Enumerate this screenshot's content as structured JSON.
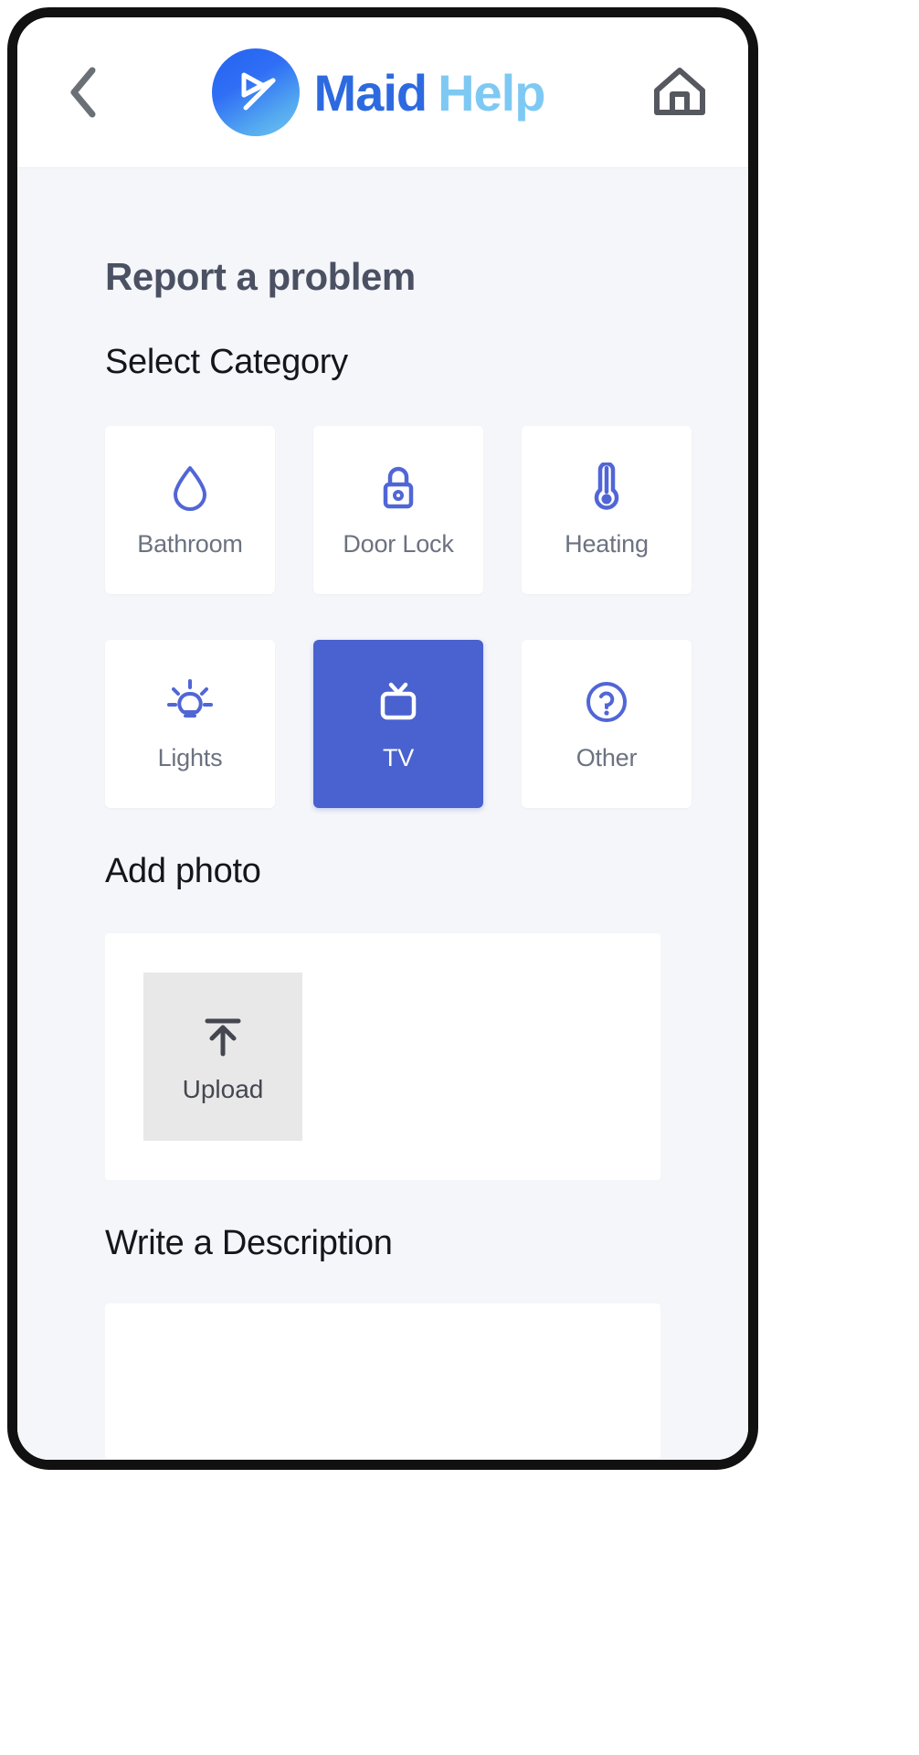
{
  "header": {
    "back_icon": "chevron-left-icon",
    "logo_icon": "maid-help-logo-icon",
    "brand_primary": "Maid",
    "brand_secondary": "Help",
    "home_icon": "home-icon"
  },
  "main": {
    "page_title": "Report a problem",
    "category_label": "Select Category",
    "categories": [
      {
        "id": "bathroom",
        "label": "Bathroom",
        "icon": "water-drop-icon",
        "selected": false
      },
      {
        "id": "door-lock",
        "label": "Door Lock",
        "icon": "lock-icon",
        "selected": false
      },
      {
        "id": "heating",
        "label": "Heating",
        "icon": "thermometer-icon",
        "selected": false
      },
      {
        "id": "lights",
        "label": "Lights",
        "icon": "lightbulb-icon",
        "selected": false
      },
      {
        "id": "tv",
        "label": "TV",
        "icon": "tv-icon",
        "selected": true
      },
      {
        "id": "other",
        "label": "Other",
        "icon": "question-circle-icon",
        "selected": false
      }
    ],
    "photo_label": "Add photo",
    "upload_label": "Upload",
    "upload_icon": "upload-arrow-icon",
    "description_label": "Write a Description",
    "description_value": "",
    "description_placeholder": ""
  },
  "colors": {
    "accent": "#4a62cf",
    "icon_blue": "#5166d6",
    "brand_primary": "#2d6ae0",
    "brand_secondary": "#7ec9f3",
    "page_bg": "#f5f6fa",
    "tile_bg": "#ffffff",
    "label_gray": "#6b7280"
  }
}
